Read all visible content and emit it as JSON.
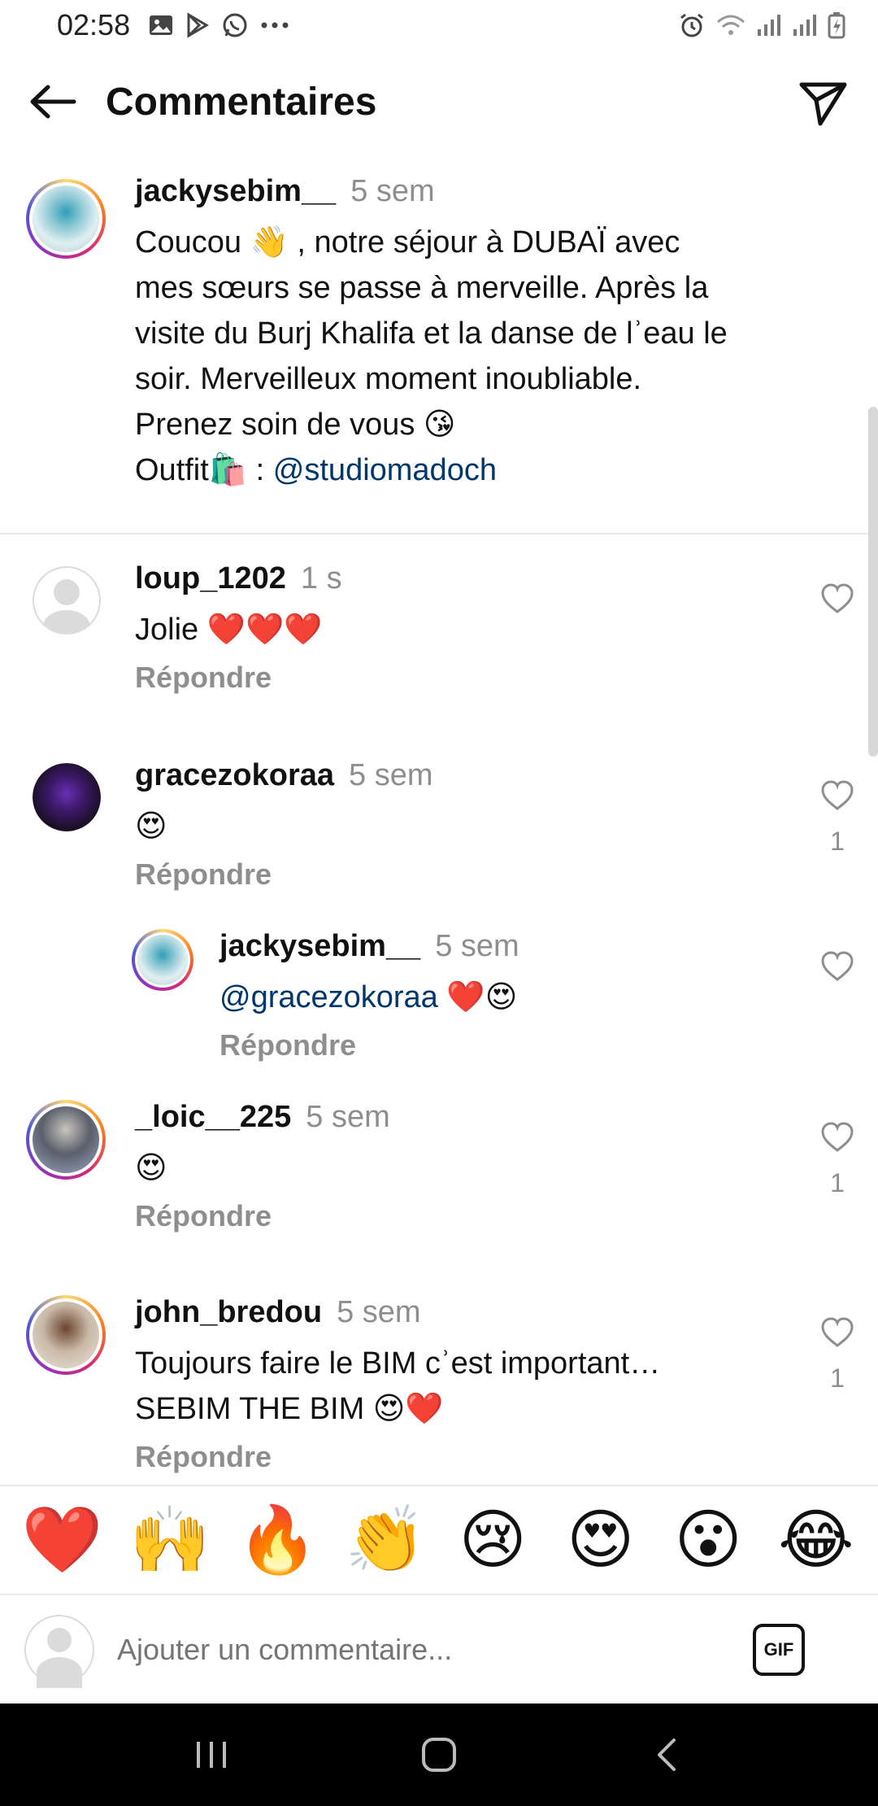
{
  "status_bar": {
    "time": "02:58",
    "left_icons": [
      "gallery-icon",
      "play-store-icon",
      "whatsapp-icon",
      "more-dots-icon"
    ],
    "right_icons": [
      "alarm-icon",
      "wifi-icon",
      "signal-icon",
      "signal-icon",
      "battery-icon"
    ]
  },
  "header": {
    "title": "Commentaires",
    "back_icon": "arrow-left-icon",
    "share_icon": "send-icon"
  },
  "caption": {
    "username": "jackysebim__",
    "time": "5 sem",
    "line1": "Coucou 👋 , notre séjour à DUBAÏ avec",
    "line2": "mes sœurs se passe à merveille. Après la",
    "line3": "visite du Burj Khalifa et la danse de lʾeau le",
    "line4": "soir. Merveilleux moment inoubliable.",
    "line5": "Prenez soin de vous 😘",
    "outfit_prefix": "Outfit🛍️ : ",
    "outfit_mention": "@studiomadoch"
  },
  "comments": [
    {
      "username": "loup_1202",
      "time": "1 s",
      "text": "Jolie ❤️❤️❤️",
      "reply": "Répondre",
      "likes": ""
    },
    {
      "username": "gracezokoraa",
      "time": "5 sem",
      "text": "😍",
      "reply": "Répondre",
      "likes": "1"
    },
    {
      "username": "jackysebim__",
      "time": "5 sem",
      "mention": "@gracezokoraa",
      "text": " ❤️😍",
      "reply": "Répondre",
      "likes": ""
    },
    {
      "username": "_loic__225",
      "time": "5 sem",
      "text": "😍",
      "reply": "Répondre",
      "likes": "1"
    },
    {
      "username": "john_bredou",
      "time": "5 sem",
      "text": "Toujours faire le BIM cʾest important…",
      "text2": "SEBIM THE BIM 😍❤️",
      "reply": "Répondre",
      "likes": "1"
    }
  ],
  "emoji_bar": [
    "❤️",
    "🙌",
    "🔥",
    "👏",
    "😢",
    "😍",
    "😮",
    "😂"
  ],
  "input": {
    "placeholder": "Ajouter un commentaire...",
    "gif_label": "GIF"
  },
  "navbar": [
    "recent-apps-icon",
    "home-icon",
    "back-icon"
  ]
}
